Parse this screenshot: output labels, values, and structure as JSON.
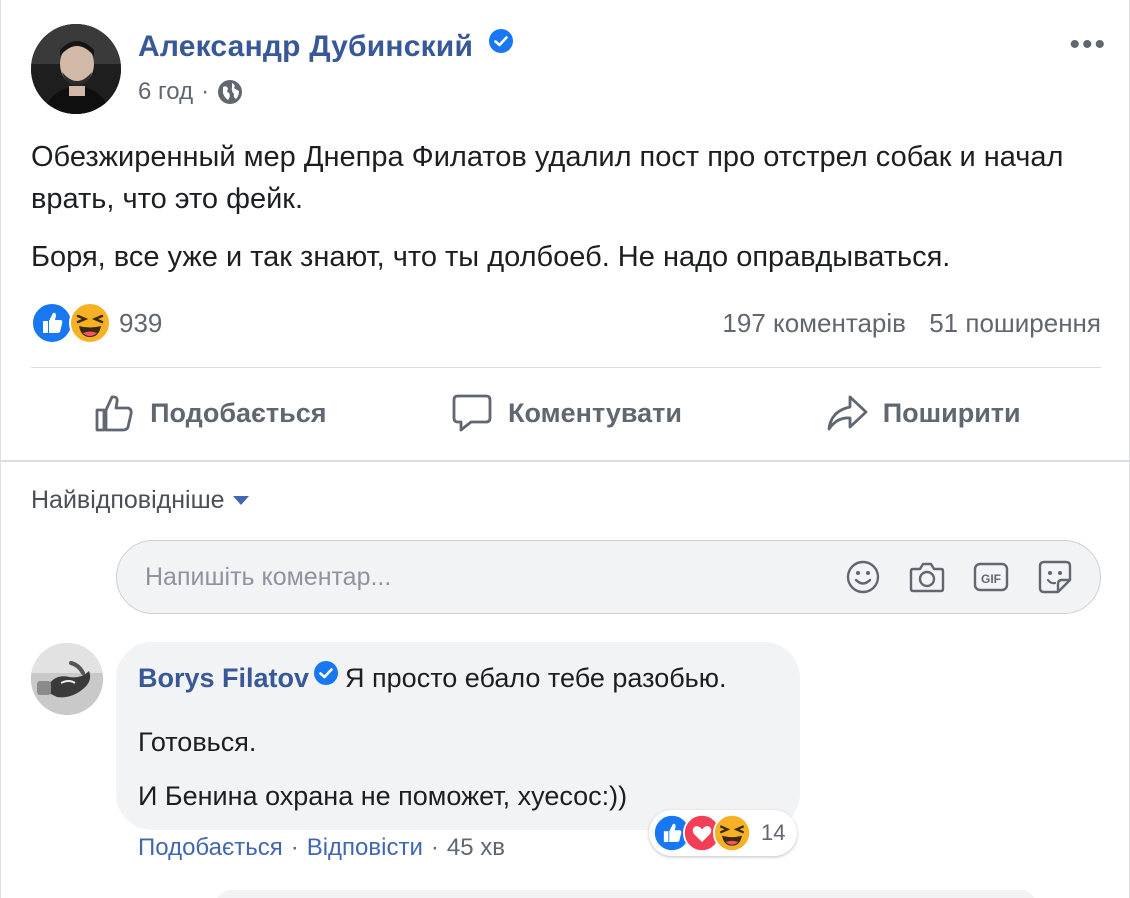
{
  "post": {
    "author": "Александр Дубинский",
    "time": "6 год",
    "meta_separator": "·",
    "more_label": "•••",
    "paragraphs": [
      "Обезжиренный мер Днепра Филатов удалил пост про отстрел собак и начал врать, что это фейк.",
      "Боря, все уже и так знают, что ты долбоеб. Не надо оправдываться."
    ],
    "reaction_count": "939",
    "comments_count": "197 коментарів",
    "shares_count": "51 поширення"
  },
  "actions": {
    "like": "Подобається",
    "comment": "Коментувати",
    "share": "Поширити"
  },
  "sort": {
    "label": "Найвідповідніше"
  },
  "comment_input": {
    "placeholder": "Напишіть коментар..."
  },
  "comment": {
    "author": "Borys Filatov",
    "line1": "Я просто ебало тебе разобью.",
    "line2": "Готовься.",
    "line3": "И Бенина охрана не поможет, хуесос:))",
    "reaction_count": "14",
    "like_label": "Подобається",
    "reply_label": "Відповісти",
    "time": "45 хв",
    "separator": "·"
  },
  "colors": {
    "link_blue": "#385898",
    "action_blue": "#4267b2",
    "gray_text": "#606770",
    "bubble_bg": "#f2f3f5",
    "verified": "#1877f2",
    "like_blue": "#1877f2",
    "haha_yellow": "#f7b125",
    "love_red": "#f33e58"
  },
  "icons": [
    "verified-badge-icon",
    "globe-icon",
    "like-reaction-icon",
    "haha-reaction-icon",
    "love-reaction-icon",
    "thumbs-up-icon",
    "comment-icon",
    "share-icon",
    "emoji-icon",
    "camera-icon",
    "gif-icon",
    "sticker-icon"
  ]
}
